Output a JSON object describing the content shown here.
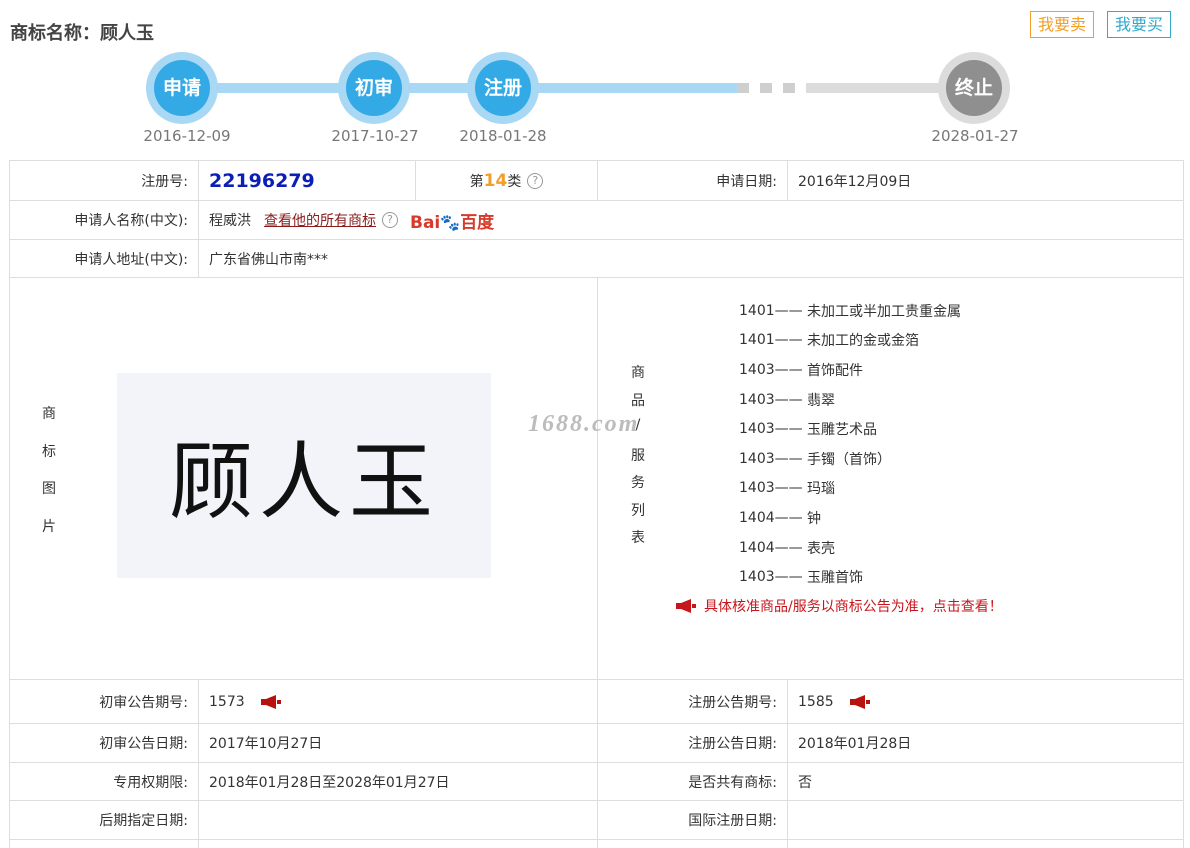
{
  "header": {
    "title": "商标名称：顾人玉",
    "sell_label": "我要卖",
    "buy_label": "我要买"
  },
  "timeline": {
    "steps": [
      {
        "label": "申请",
        "date": "2016-12-09"
      },
      {
        "label": "初审",
        "date": "2017-10-27"
      },
      {
        "label": "注册",
        "date": "2018-01-28"
      },
      {
        "label": "终止",
        "date": "2028-01-27"
      }
    ]
  },
  "info": {
    "reg_no_label": "注册号:",
    "reg_no": "22196279",
    "class_prefix": "第",
    "class_num": "14",
    "class_suffix": "类",
    "help_mark": "?",
    "apply_date_label": "申请日期:",
    "apply_date": "2016年12月09日",
    "applicant_label": "申请人名称(中文):",
    "applicant": "程威洪",
    "all_marks_link": "查看他的所有商标",
    "baidu_text": "Bai",
    "baidu_paw": "🐾",
    "baidu_cn": "百度",
    "address_label": "申请人地址(中文):",
    "address": "广东省佛山市南***"
  },
  "image_section": {
    "label_chars": [
      "商",
      "标",
      "图",
      "片"
    ],
    "trademark_text": "顾人玉",
    "watermark": "1688.com"
  },
  "goods_section": {
    "label_chars": [
      "商",
      "品",
      "/",
      "服",
      "务",
      "列",
      "表"
    ],
    "items": [
      {
        "code": "1401——",
        "name": "未加工或半加工贵重金属"
      },
      {
        "code": "1401——",
        "name": "未加工的金或金箔"
      },
      {
        "code": "1403——",
        "name": "首饰配件"
      },
      {
        "code": "1403——",
        "name": "翡翠"
      },
      {
        "code": "1403——",
        "name": "玉雕艺术品"
      },
      {
        "code": "1403——",
        "name": "手镯（首饰）"
      },
      {
        "code": "1403——",
        "name": "玛瑙"
      },
      {
        "code": "1404——",
        "name": "钟"
      },
      {
        "code": "1404——",
        "name": "表壳"
      },
      {
        "code": "1403——",
        "name": "玉雕首饰"
      }
    ],
    "notice": "具体核准商品/服务以商标公告为准，点击查看！"
  },
  "bottom": {
    "prelim_no_label": "初审公告期号:",
    "prelim_no": "1573",
    "reg_pub_no_label": "注册公告期号:",
    "reg_pub_no": "1585",
    "prelim_date_label": "初审公告日期:",
    "prelim_date": "2017年10月27日",
    "reg_pub_date_label": "注册公告日期:",
    "reg_pub_date": "2018年01月28日",
    "exclusive_label": "专用权期限:",
    "exclusive": "2018年01月28日至2028年01月27日",
    "shared_label": "是否共有商标:",
    "shared": "否",
    "later_label": "后期指定日期:",
    "later": "",
    "intl_label": "国际注册日期:",
    "intl": ""
  },
  "colors": {
    "accent_blue": "#33a9e6",
    "progress_blue": "#a8d8f3",
    "end_gray": "#8f8f8f",
    "sell_orange": "#f0a028",
    "buy_teal": "#33a9cc",
    "notice_red": "#c7161b",
    "reg_no_blue": "#0b1fb7"
  },
  "icons": {
    "help": "question-circle-icon",
    "horn": "megaphone-icon",
    "baidu": "baidu-logo"
  }
}
